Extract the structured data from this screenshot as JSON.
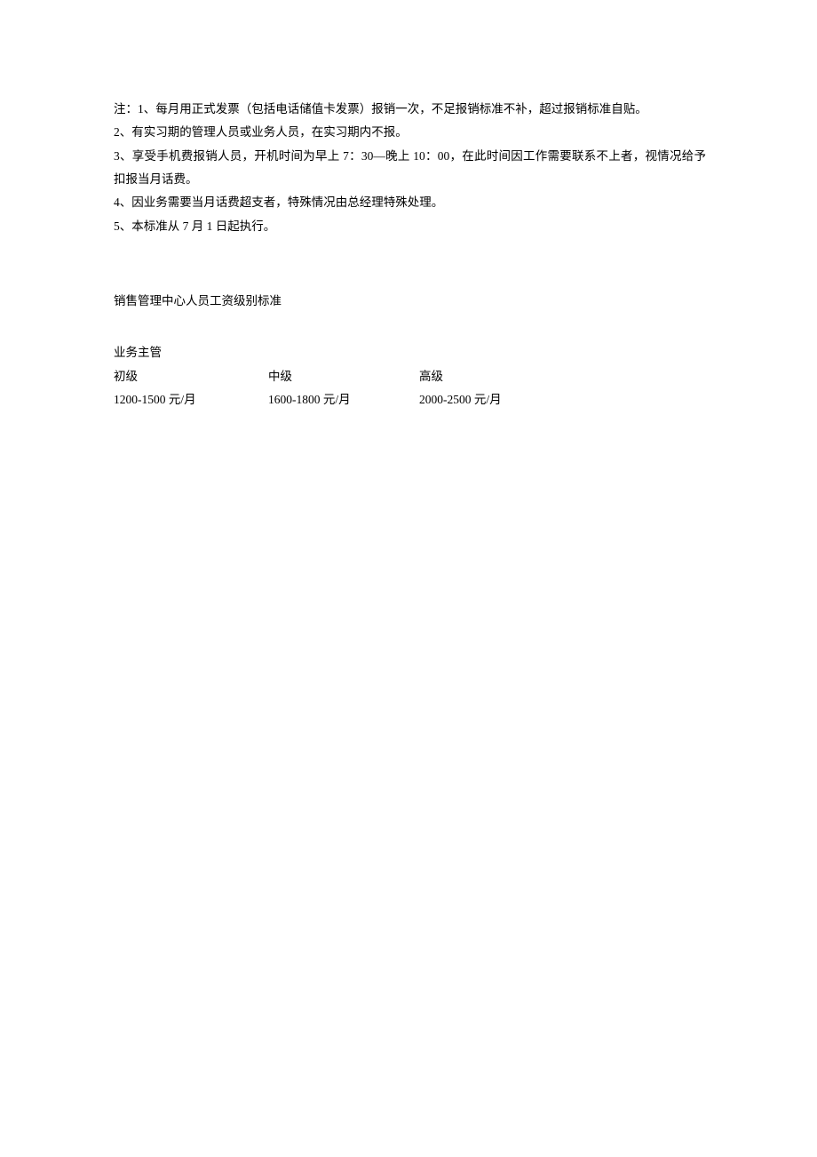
{
  "notes": {
    "line1": "注：1、每月用正式发票（包括电话储值卡发票）报销一次，不足报销标准不补，超过报销标准自贴。",
    "line2": "2、有实习期的管理人员或业务人员，在实习期内不报。",
    "line3": "3、享受手机费报销人员，开机时间为早上 7：30—晚上 10：00，在此时间因工作需要联系不上者，视情况给予扣报当月话费。",
    "line4": "4、因业务需要当月话费超支者，特殊情况由总经理特殊处理。",
    "line5": "5、本标准从 7 月 1 日起执行。"
  },
  "section_title": "销售管理中心人员工资级别标准",
  "role_title": "业务主管",
  "salary": {
    "level1": {
      "label": "初级",
      "amount": "1200-1500 元/月"
    },
    "level2": {
      "label": "中级",
      "amount": "1600-1800 元/月"
    },
    "level3": {
      "label": "高级",
      "amount": "2000-2500 元/月"
    }
  }
}
